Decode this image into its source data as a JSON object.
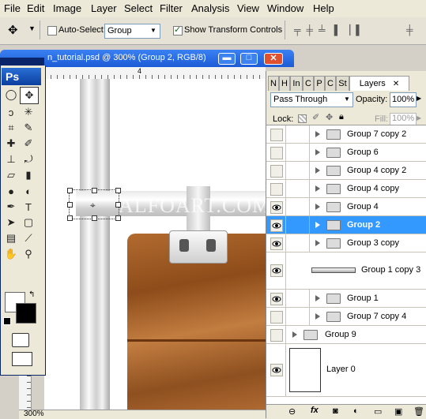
{
  "menubar": {
    "items": [
      "File",
      "Edit",
      "Image",
      "Layer",
      "Select",
      "Filter",
      "Analysis",
      "View",
      "Window",
      "Help"
    ]
  },
  "options": {
    "auto_select_label": "Auto-Select:",
    "auto_select_value": "Group",
    "show_transform_label": "Show Transform Controls",
    "auto_select_checked": false,
    "show_transform_checked": true
  },
  "document": {
    "title": "n_tutorial.psd @ 300% (Group 2, RGB/8)",
    "ruler_mark": "4",
    "zoom": "300%",
    "watermark": "ALFOART.COM"
  },
  "toolbox": {
    "logo": "Ps"
  },
  "layers_panel": {
    "tabs": [
      "N",
      "H",
      "In",
      "C",
      "P",
      "C",
      "St",
      "Layers"
    ],
    "active_tab": "Layers",
    "blend_mode": "Pass Through",
    "opacity_label": "Opacity:",
    "opacity_value": "100%",
    "lock_label": "Lock:",
    "fill_label": "Fill:",
    "fill_value": "100%",
    "layers": [
      {
        "name": "Group 7 copy 2",
        "type": "group",
        "visible": false,
        "indent": true,
        "selected": false
      },
      {
        "name": "Group 6",
        "type": "group",
        "visible": false,
        "indent": true,
        "selected": false
      },
      {
        "name": "Group 4 copy 2",
        "type": "group",
        "visible": false,
        "indent": true,
        "selected": false
      },
      {
        "name": "Group 4 copy",
        "type": "group",
        "visible": false,
        "indent": true,
        "selected": false
      },
      {
        "name": "Group 4",
        "type": "group",
        "visible": true,
        "indent": true,
        "selected": false
      },
      {
        "name": "Group 2",
        "type": "group",
        "visible": true,
        "indent": true,
        "selected": true
      },
      {
        "name": "Group 3 copy",
        "type": "group",
        "visible": true,
        "indent": true,
        "selected": false
      },
      {
        "name": "Group 1 copy 3",
        "type": "layer",
        "visible": true,
        "indent": true,
        "selected": false
      },
      {
        "name": "Group 1",
        "type": "group",
        "visible": true,
        "indent": true,
        "selected": false
      },
      {
        "name": "Group 7 copy 4",
        "type": "group",
        "visible": false,
        "indent": true,
        "selected": false
      },
      {
        "name": "Group 9",
        "type": "group",
        "visible": false,
        "indent": false,
        "selected": false
      },
      {
        "name": "Layer 0",
        "type": "layer",
        "visible": true,
        "indent": false,
        "selected": false
      }
    ]
  },
  "colors": {
    "accent": "#3399ff",
    "titlebar": "#2a6fe6",
    "wood": "#a0612a"
  }
}
